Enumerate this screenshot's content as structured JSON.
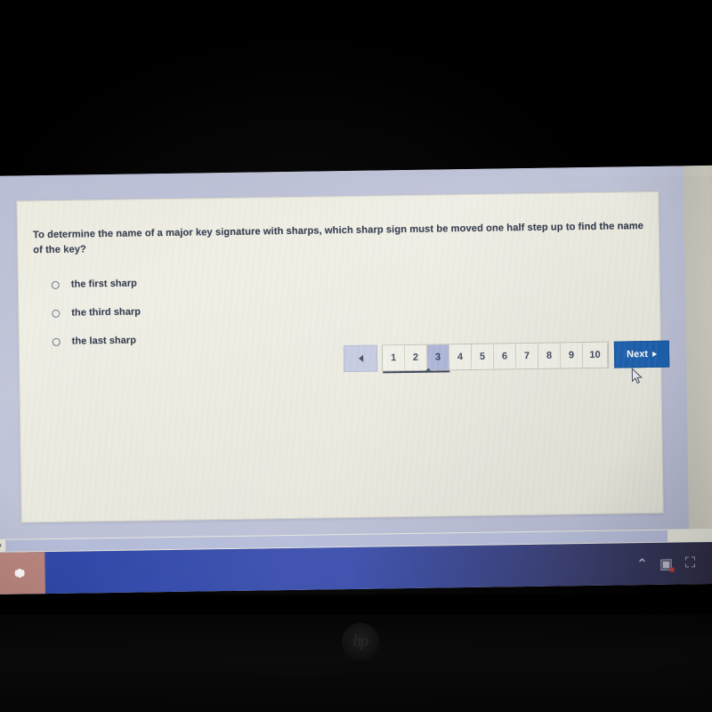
{
  "photo": {
    "device_logo": "hp",
    "logo_icon": "hp-logo"
  },
  "quiz": {
    "question": "To determine the name of a major key signature with sharps, which sharp sign must be moved one half step up to find the name of the key?",
    "options": [
      {
        "label": "the first sharp",
        "selected": false
      },
      {
        "label": "the third sharp",
        "selected": false
      },
      {
        "label": "the last sharp",
        "selected": false
      }
    ]
  },
  "pagination": {
    "prev_icon": "triangle-left-icon",
    "pages": [
      "1",
      "2",
      "3",
      "4",
      "5",
      "6",
      "7",
      "8",
      "9",
      "10"
    ],
    "current_page": "3",
    "next_label": "Next",
    "next_icon": "triangle-right-icon",
    "accent_color": "#1a5fae",
    "active_page_color": "#aab2d6"
  },
  "scrollbar": {
    "left_arrow": "◄",
    "right_arrow": "►"
  },
  "taskbar": {
    "app_tile_icon": "gear-icon",
    "tile_color": "#b9857d",
    "tray": [
      {
        "icon": "chevron-up-icon",
        "glyph": "⌃"
      },
      {
        "icon": "notification-app-icon",
        "glyph": "▣",
        "badge": true
      },
      {
        "icon": "network-icon",
        "glyph": "⛶"
      },
      {
        "icon": "speaker-icon",
        "glyph": "◖"
      }
    ]
  },
  "cursor": {
    "icon": "mouse-pointer-icon"
  }
}
